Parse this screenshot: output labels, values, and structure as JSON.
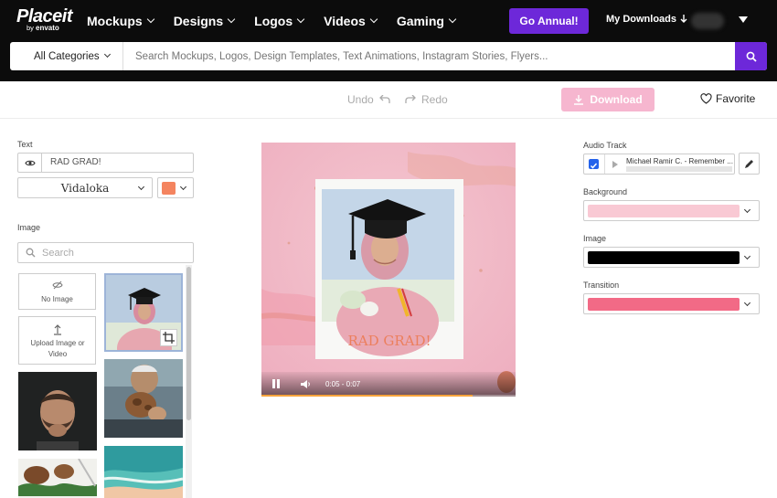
{
  "logo": {
    "brand": "Placeit",
    "sub_prefix": "by",
    "sub_name": "envato"
  },
  "nav": {
    "links": [
      "Mockups",
      "Designs",
      "Logos",
      "Videos",
      "Gaming"
    ],
    "go_annual": "Go Annual!",
    "my_downloads": "My Downloads"
  },
  "search": {
    "category": "All Categories",
    "placeholder": "Search Mockups, Logos, Design Templates, Text Animations, Instagram Stories, Flyers..."
  },
  "toolbar": {
    "undo": "Undo",
    "redo": "Redo",
    "download": "Download",
    "favorite": "Favorite"
  },
  "left": {
    "text_label": "Text",
    "text_value": "RAD GRAD!",
    "font": "Vidaloka",
    "text_color": "#f4845f",
    "image_label": "Image",
    "image_search_placeholder": "Search",
    "no_image": "No Image",
    "upload": "Upload Image or Video"
  },
  "preview": {
    "headline": "RAD GRAD!",
    "timecode": "0:05 - 0:07",
    "progress": 0.83
  },
  "right": {
    "audio_label": "Audio Track",
    "audio_title": "Michael Ramir C. - Remember ...",
    "background_label": "Background",
    "background_color": "#f9c9d4",
    "image_label": "Image",
    "image_color": "#000000",
    "transition_label": "Transition",
    "transition_color": "#f26a86"
  }
}
